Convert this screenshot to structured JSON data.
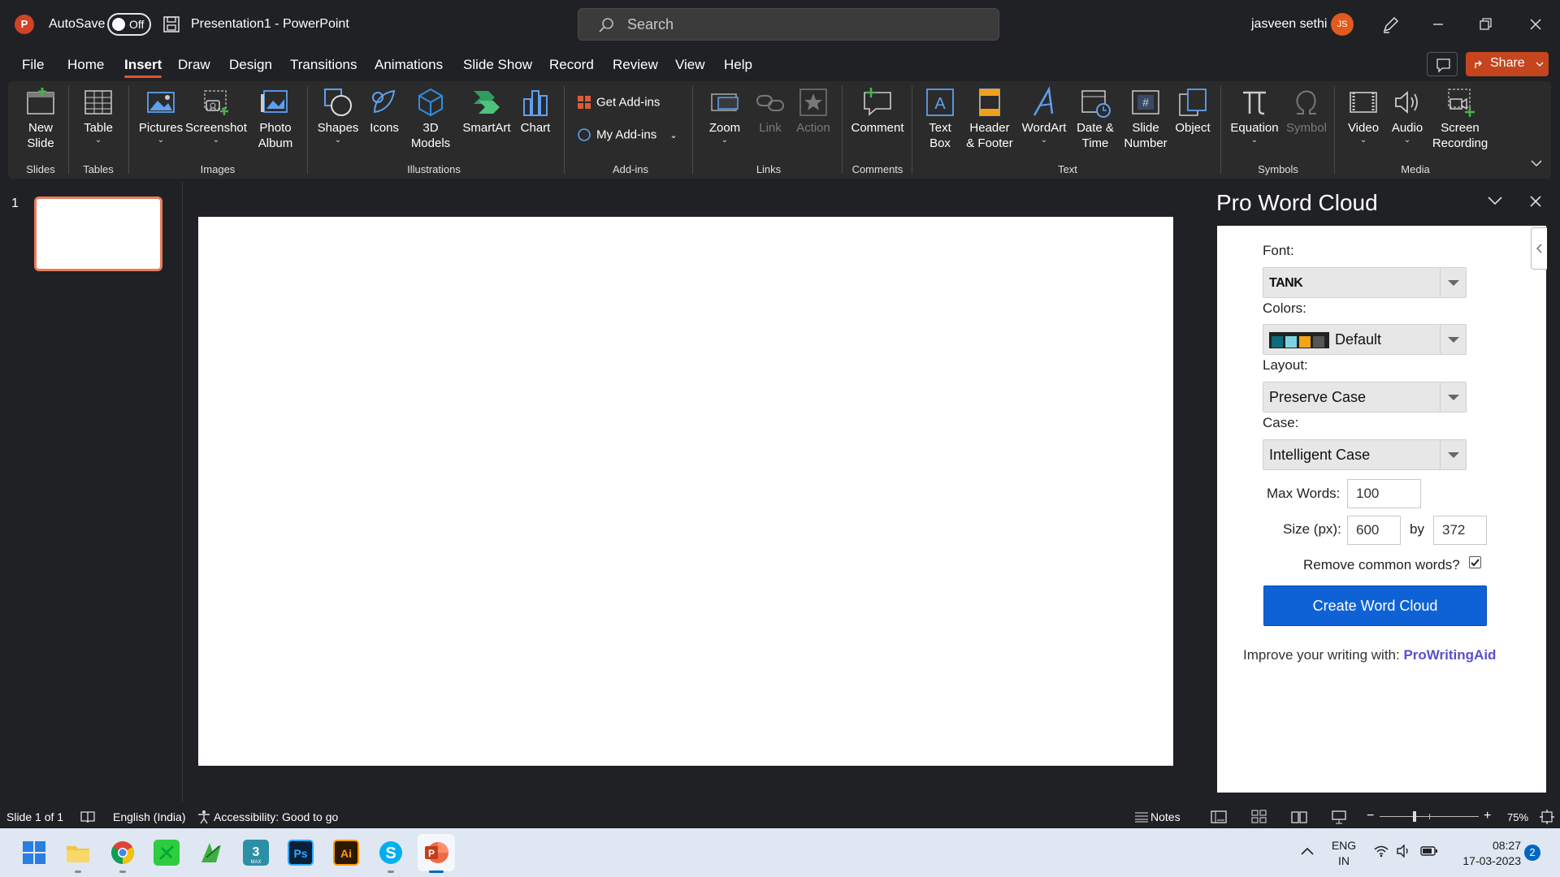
{
  "titlebar": {
    "autosave_label": "AutoSave",
    "autosave_state": "Off",
    "doc_title": "Presentation1  -  PowerPoint",
    "search_placeholder": "Search",
    "user_name": "jasveen sethi",
    "user_initials": "JS"
  },
  "menu": {
    "tabs": [
      "File",
      "Home",
      "Insert",
      "Draw",
      "Design",
      "Transitions",
      "Animations",
      "Slide Show",
      "Record",
      "Review",
      "View",
      "Help"
    ],
    "active_tab": "Insert",
    "share_label": "Share"
  },
  "ribbon": {
    "new_slide": "New\nSlide",
    "table": "Table",
    "pictures": "Pictures",
    "screenshot": "Screenshot",
    "photo_album": "Photo\nAlbum",
    "shapes": "Shapes",
    "icons": "Icons",
    "models_3d": "3D\nModels",
    "smartart": "SmartArt",
    "chart": "Chart",
    "get_addins": "Get Add-ins",
    "my_addins": "My Add-ins",
    "zoom": "Zoom",
    "link": "Link",
    "action": "Action",
    "comment": "Comment",
    "text_box": "Text\nBox",
    "header_footer": "Header\n& Footer",
    "wordart": "WordArt",
    "date_time": "Date &\nTime",
    "slide_number": "Slide\nNumber",
    "object": "Object",
    "equation": "Equation",
    "symbol": "Symbol",
    "video": "Video",
    "audio": "Audio",
    "screen_recording": "Screen\nRecording",
    "groups": {
      "slides": "Slides",
      "tables": "Tables",
      "images": "Images",
      "illustrations": "Illustrations",
      "addins": "Add-ins",
      "links": "Links",
      "comments": "Comments",
      "text": "Text",
      "symbols": "Symbols",
      "media": "Media"
    }
  },
  "thumbnails": {
    "slide_number": "1"
  },
  "pane": {
    "title": "Pro Word Cloud",
    "font_label": "Font:",
    "font_value": "TANK",
    "colors_label": "Colors:",
    "colors_value": "Default",
    "color_swatches": [
      "#0d6b7a",
      "#7fd3e0",
      "#f5a31a",
      "#555555"
    ],
    "layout_label": "Layout:",
    "layout_value": "Preserve Case",
    "case_label": "Case:",
    "case_value": "Intelligent Case",
    "max_words_label": "Max Words:",
    "max_words_value": "100",
    "size_label": "Size (px):",
    "size_width": "600",
    "size_by": "by",
    "size_height": "372",
    "remove_common_label": "Remove common words?",
    "remove_common_checked": true,
    "create_button": "Create Word Cloud",
    "improve_text": "Improve your writing with:",
    "improve_link": "ProWritingAid"
  },
  "statusbar": {
    "slide_info": "Slide 1 of 1",
    "language": "English (India)",
    "accessibility": "Accessibility: Good to go",
    "notes": "Notes",
    "zoom_level": "75%"
  },
  "taskbar": {
    "lang_line1": "ENG",
    "lang_line2": "IN",
    "time": "08:27",
    "date": "17-03-2023",
    "notification_count": "2"
  }
}
